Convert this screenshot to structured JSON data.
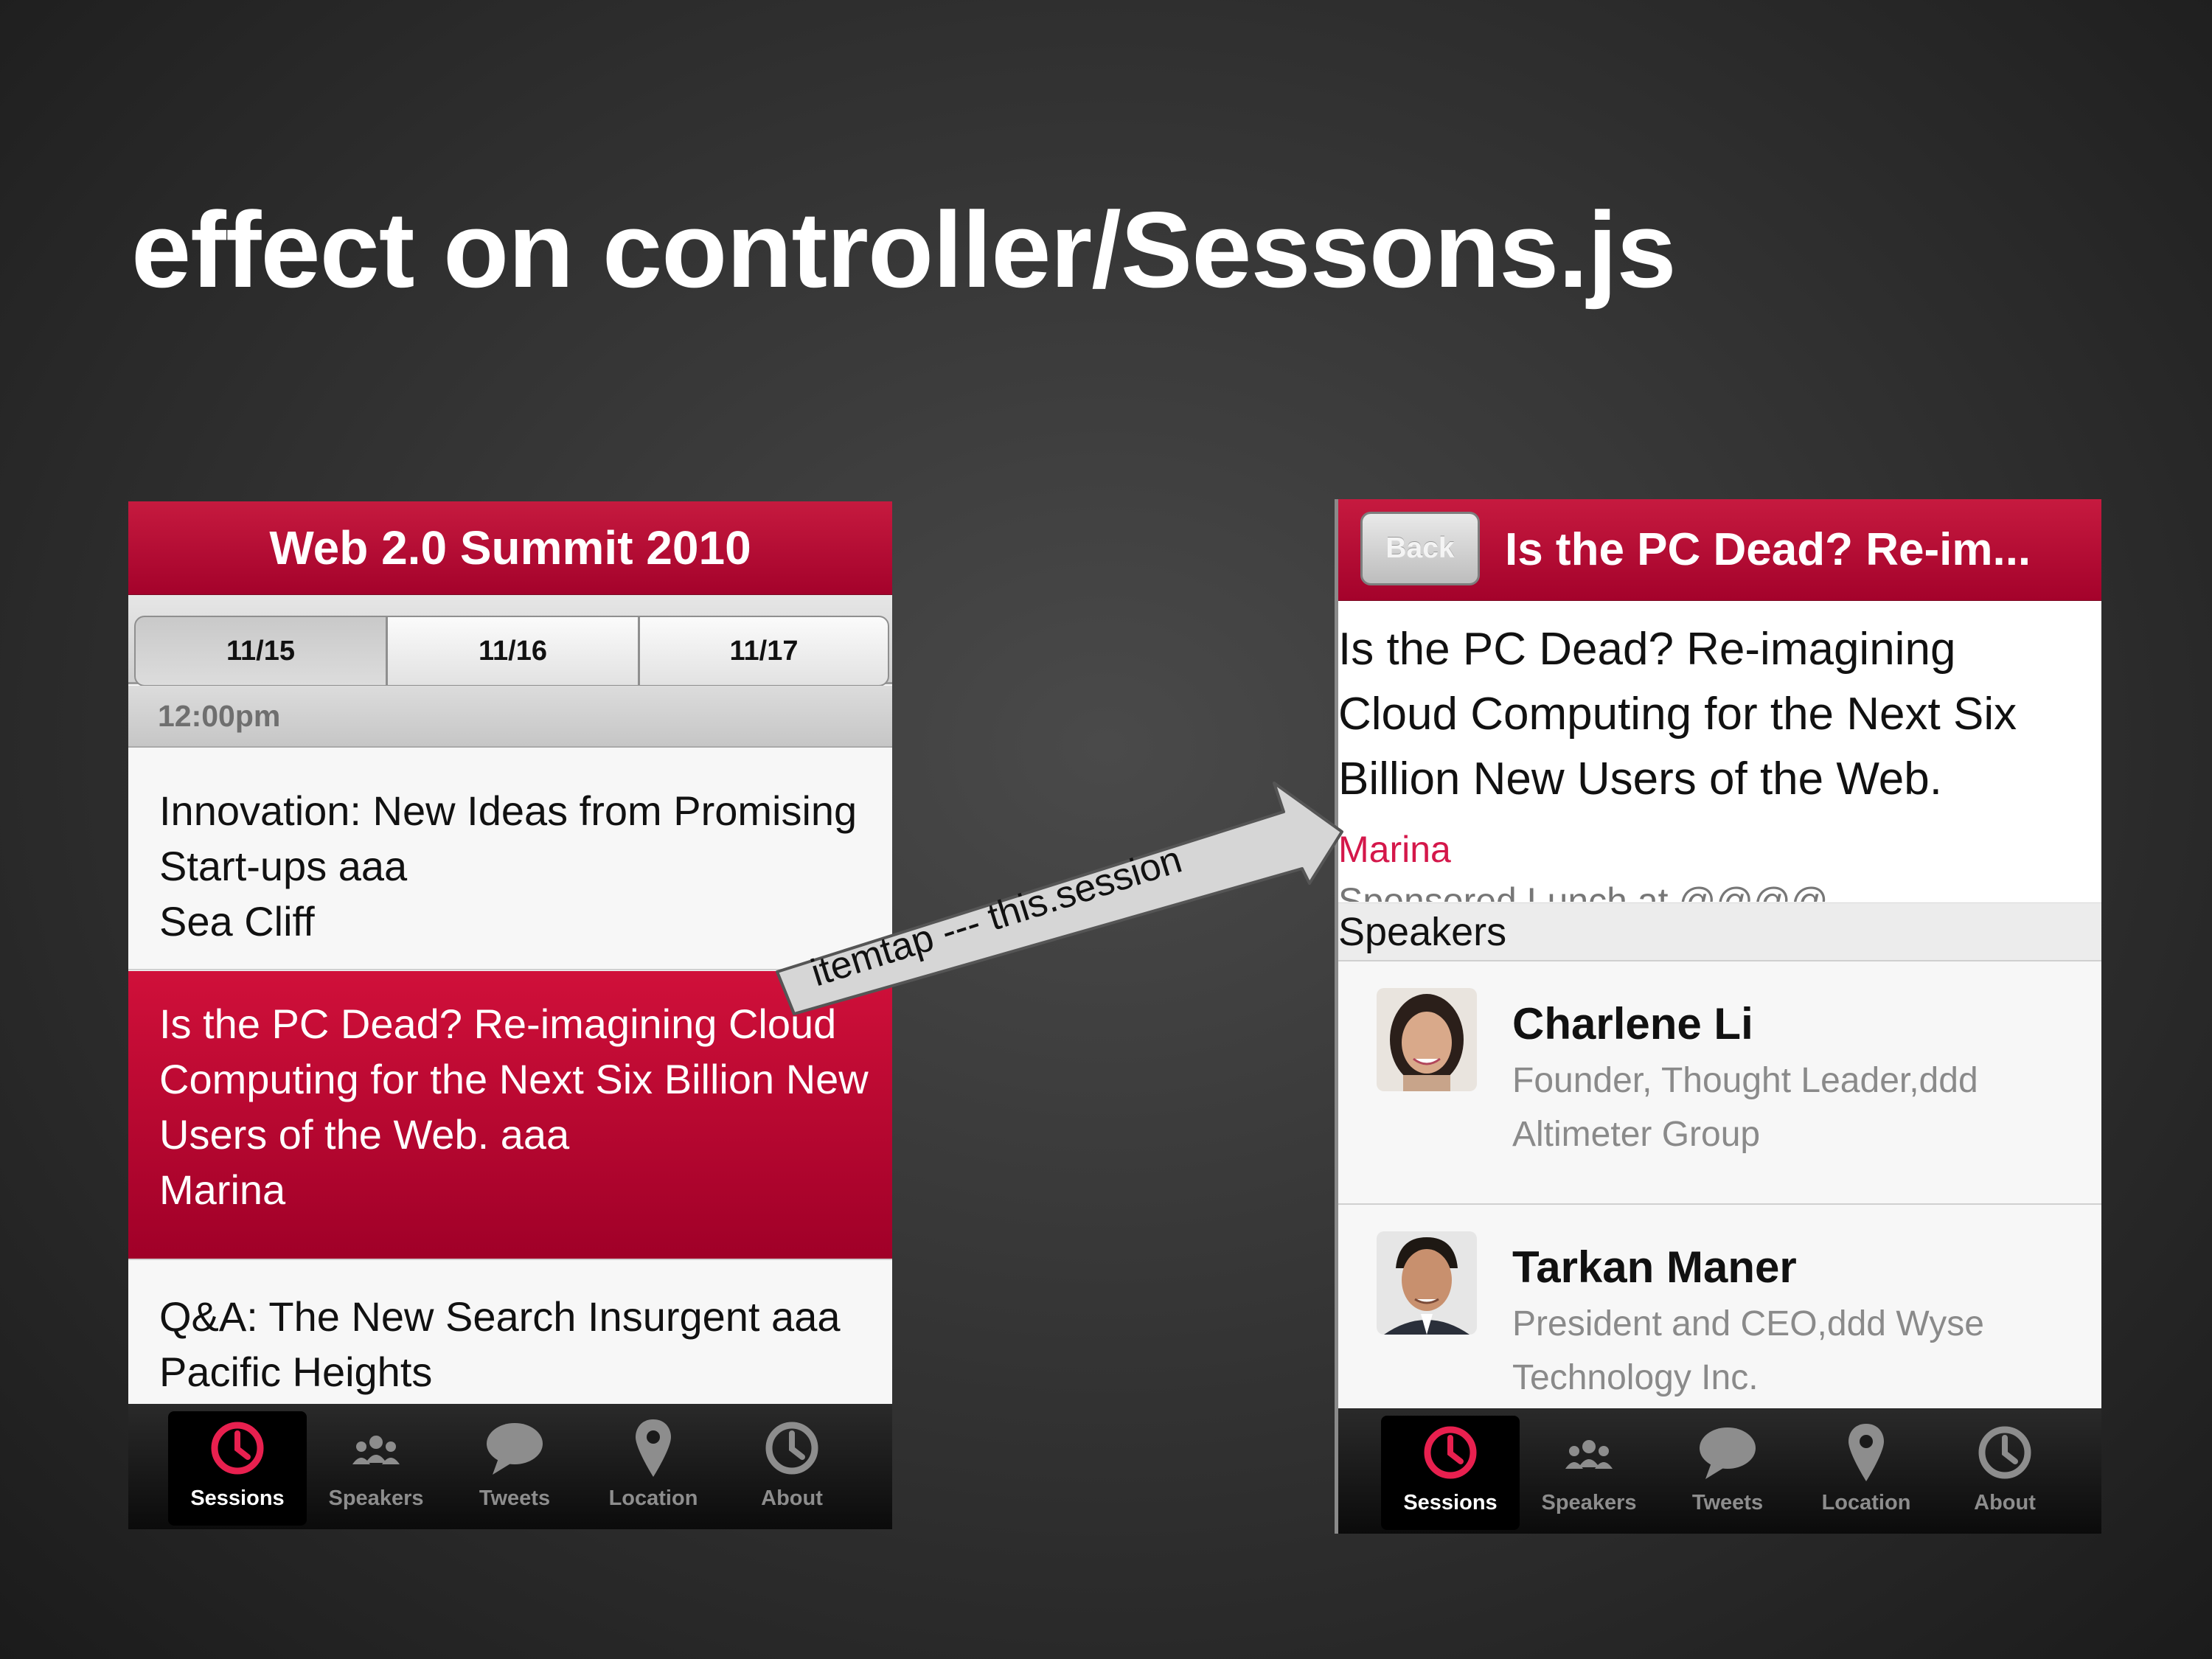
{
  "slide": {
    "title": "effect on controller/Sessons.js"
  },
  "annotation": {
    "label": "itemtap --- this.session"
  },
  "left_phone": {
    "title": "Web 2.0 Summit 2010",
    "date_tabs": [
      "11/15",
      "11/16",
      "11/17"
    ],
    "group_header": "12:00pm",
    "sessions": [
      {
        "lines": [
          "Innovation: New Ideas from Promising",
          "Start-ups aaa"
        ],
        "room": "Sea Cliff"
      },
      {
        "lines": [
          "Is the PC Dead? Re-imagining Cloud",
          "Computing for the Next Six Billion New",
          "Users of the Web. aaa"
        ],
        "room": "Marina"
      },
      {
        "lines": [
          "Q&A: The New Search Insurgent aaa"
        ],
        "room": "Pacific Heights"
      }
    ]
  },
  "right_phone": {
    "back_label": "Back",
    "title": "Is the PC Dead? Re-im...",
    "heading_lines": [
      "Is the PC Dead? Re-imagining",
      "Cloud Computing for the Next Six",
      "Billion New Users of the Web."
    ],
    "room": "Marina",
    "description": "Sponsored Lunch at @@@@",
    "speakers_header": "Speakers",
    "speakers": [
      {
        "name": "Charlene Li",
        "position_lines": [
          "Founder, Thought Leader,ddd",
          "Altimeter Group"
        ]
      },
      {
        "name": "Tarkan Maner",
        "position_lines": [
          "President and CEO,ddd Wyse",
          "Technology Inc."
        ]
      }
    ]
  },
  "tabbar": {
    "tabs": [
      {
        "label": "Sessions",
        "icon": "clock-icon",
        "active": true
      },
      {
        "label": "Speakers",
        "icon": "people-icon",
        "active": false
      },
      {
        "label": "Tweets",
        "icon": "speech-bubble-icon",
        "active": false
      },
      {
        "label": "Location",
        "icon": "map-pin-icon",
        "active": false
      },
      {
        "label": "About",
        "icon": "clock-icon",
        "active": false
      }
    ]
  },
  "colors": {
    "accent": "#c0103a",
    "room_text": "#d4174a",
    "slide_background": "#2e2e2e"
  }
}
